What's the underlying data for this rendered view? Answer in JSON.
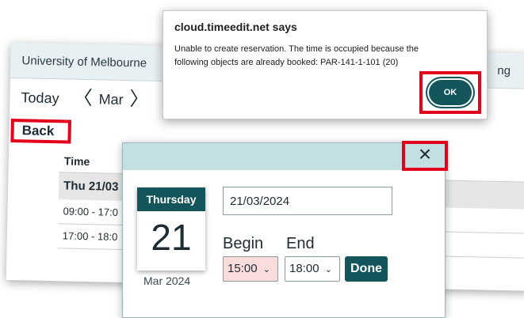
{
  "header": {
    "org_name": "University of Melbourne",
    "tail_text": "ng"
  },
  "nav": {
    "today_label": "Today",
    "prev_glyph": "〈",
    "month_label": "Mar",
    "next_glyph": "〉"
  },
  "back_label": "Back",
  "table": {
    "time_header": "Time",
    "day_row": "Thu 21/03",
    "slots": [
      "09:00 - 17:0",
      "17:00 - 18:0"
    ]
  },
  "date_dialog": {
    "close_glyph": "×",
    "calendar": {
      "weekday": "Thursday",
      "day": "21",
      "month_year": "Mar 2024"
    },
    "date_value": "21/03/2024",
    "begin_label": "Begin",
    "end_label": "End",
    "begin_value": "15:00",
    "end_value": "18:00",
    "caret_glyph": "⌄",
    "done_label": "Done"
  },
  "alert": {
    "title": "cloud.timeedit.net says",
    "message": "Unable to create reservation.  The time is occupied because the following  objects are already booked: PAR-141-1-101 (20)",
    "ok_label": "OK"
  },
  "colors": {
    "accent": "#14555c",
    "highlight": "#e0001b",
    "header_bg": "#e8f0f3",
    "dialog_header_bg": "#c3dfe1",
    "begin_select_bg": "#fbdcdc"
  }
}
